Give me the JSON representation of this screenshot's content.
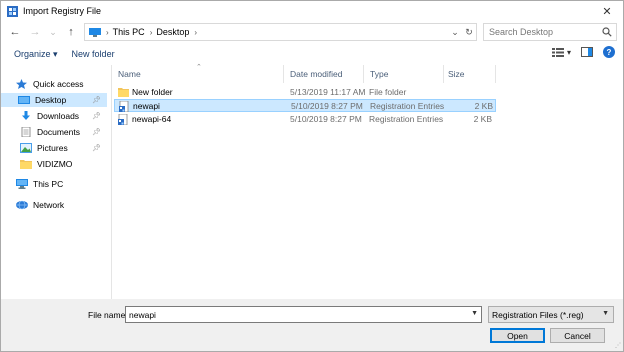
{
  "window": {
    "title": "Import Registry File",
    "close_glyph": "✕"
  },
  "nav": {
    "back_glyph": "←",
    "forward_glyph": "→",
    "recent_glyph": "⌄",
    "up_glyph": "↑",
    "breadcrumb": [
      "This PC",
      "Desktop"
    ],
    "search_placeholder": "Search Desktop"
  },
  "toolbar": {
    "organize_label": "Organize ▾",
    "new_folder_label": "New folder",
    "view_dropdown_glyph": "▾",
    "help_glyph": "?"
  },
  "sidebar": {
    "items": [
      {
        "label": "Quick access",
        "icon": "star-icon",
        "pinned": false
      },
      {
        "label": "Desktop",
        "icon": "desktop-icon",
        "pinned": true,
        "selected": true
      },
      {
        "label": "Downloads",
        "icon": "download-icon",
        "pinned": true
      },
      {
        "label": "Documents",
        "icon": "documents-icon",
        "pinned": true
      },
      {
        "label": "Pictures",
        "icon": "pictures-icon",
        "pinned": true
      },
      {
        "label": "VIDIZMO",
        "icon": "folder-icon",
        "pinned": false
      },
      {
        "label": "This PC",
        "icon": "computer-icon",
        "pinned": false
      },
      {
        "label": "Network",
        "icon": "network-icon",
        "pinned": false
      }
    ]
  },
  "files": {
    "columns": [
      "Name",
      "Date modified",
      "Type",
      "Size"
    ],
    "rows": [
      {
        "name": "New folder",
        "date": "5/13/2019 11:17 AM",
        "type": "File folder",
        "size": "",
        "icon": "folder-icon",
        "selected": false
      },
      {
        "name": "newapi",
        "date": "5/10/2019 8:27 PM",
        "type": "Registration Entries",
        "size": "2 KB",
        "icon": "registry-file-icon",
        "selected": true
      },
      {
        "name": "newapi-64",
        "date": "5/10/2019 8:27 PM",
        "type": "Registration Entries",
        "size": "2 KB",
        "icon": "registry-file-icon",
        "selected": false
      }
    ]
  },
  "footer": {
    "file_name_label": "File name:",
    "file_name_value": "newapi",
    "filter_value": "Registration Files (*.reg)",
    "open_label": "Open",
    "cancel_label": "Cancel"
  },
  "colors": {
    "selection_bg": "#cce8ff",
    "accent": "#0078d7",
    "link_text": "#1a3e6e"
  }
}
